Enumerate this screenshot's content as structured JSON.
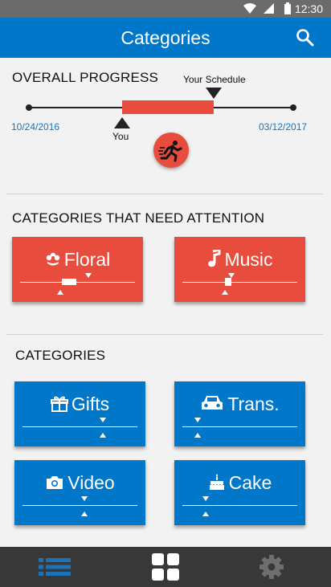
{
  "status_bar": {
    "time": "12:30"
  },
  "app_bar": {
    "title": "Categories"
  },
  "progress": {
    "heading": "OVERALL PROGRESS",
    "start_date": "10/24/2016",
    "end_date": "03/12/2017",
    "you_label": "You",
    "schedule_label": "Your Schedule",
    "you_position": 0.35,
    "schedule_position": 0.7
  },
  "attention": {
    "heading": "CATEGORIES THAT NEED ATTENTION",
    "cards": [
      {
        "label": "Floral",
        "icon": "flower-icon",
        "color": "#e84c3d"
      },
      {
        "label": "Music",
        "icon": "music-note-icon",
        "color": "#e84c3d"
      }
    ]
  },
  "categories": {
    "heading": "CATEGORIES",
    "cards": [
      {
        "label": "Gifts",
        "icon": "gift-icon",
        "color": "#0077c8"
      },
      {
        "label": "Trans.",
        "icon": "car-icon",
        "color": "#0077c8"
      },
      {
        "label": "Video",
        "icon": "camera-icon",
        "color": "#0077c8"
      },
      {
        "label": "Cake",
        "icon": "cake-icon",
        "color": "#0077c8"
      }
    ]
  },
  "bottom_nav": {
    "items": [
      "list-icon",
      "grid-icon",
      "settings-icon"
    ],
    "active": "grid-icon"
  }
}
